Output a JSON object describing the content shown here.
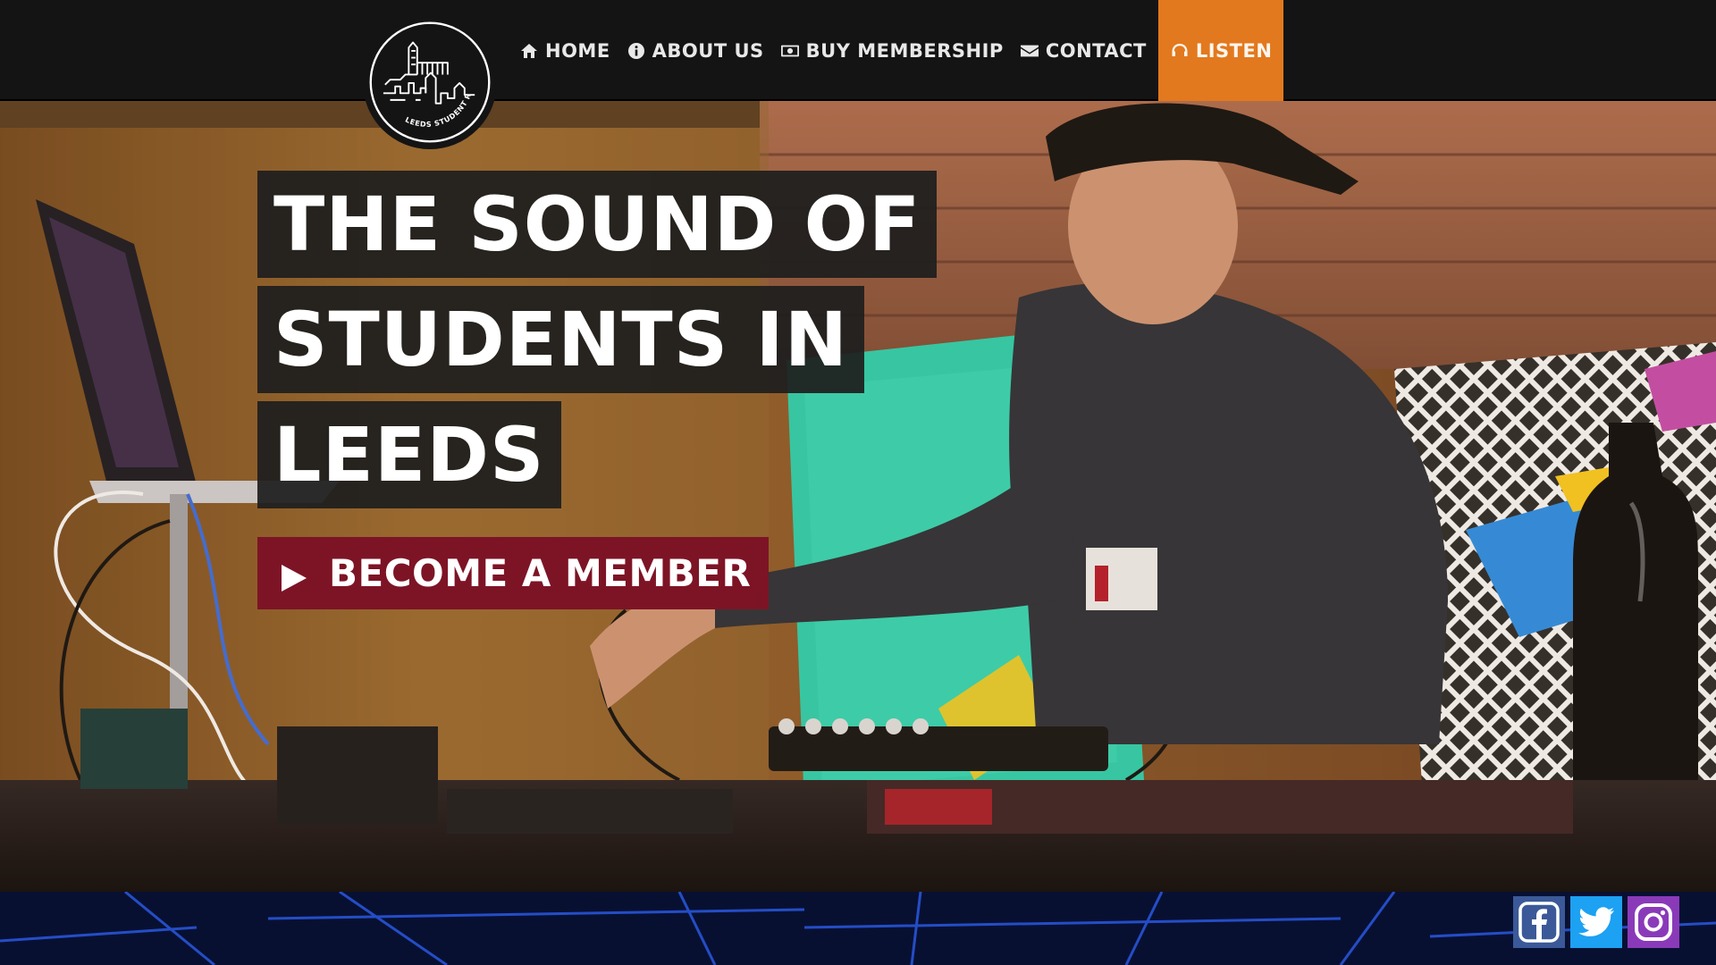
{
  "brand": {
    "logo_text": "LEEDS STUDENT RADIO"
  },
  "nav": {
    "items": [
      {
        "label": "Home",
        "icon": "home-icon"
      },
      {
        "label": "About Us",
        "icon": "info-icon"
      },
      {
        "label": "Buy Membership",
        "icon": "money-icon"
      },
      {
        "label": "Contact",
        "icon": "envelope-icon"
      },
      {
        "label": "Listen",
        "icon": "headphones-icon",
        "active": true
      }
    ]
  },
  "hero": {
    "headline_lines": [
      "The Sound of",
      "Students in",
      "Leeds"
    ],
    "cta_label": "Become a Member",
    "cta_icon": "play-icon"
  },
  "social": [
    {
      "name": "facebook",
      "icon": "facebook-icon",
      "color": "#3b5998"
    },
    {
      "name": "twitter",
      "icon": "twitter-icon",
      "color": "#1da1f2"
    },
    {
      "name": "instagram",
      "icon": "instagram-icon",
      "color": "#8a3ab9"
    }
  ],
  "colors": {
    "nav_bg": "#141414",
    "accent_orange": "#e2791e",
    "cta_maroon": "#7d1426",
    "headline_bg": "#1e1e1e"
  }
}
